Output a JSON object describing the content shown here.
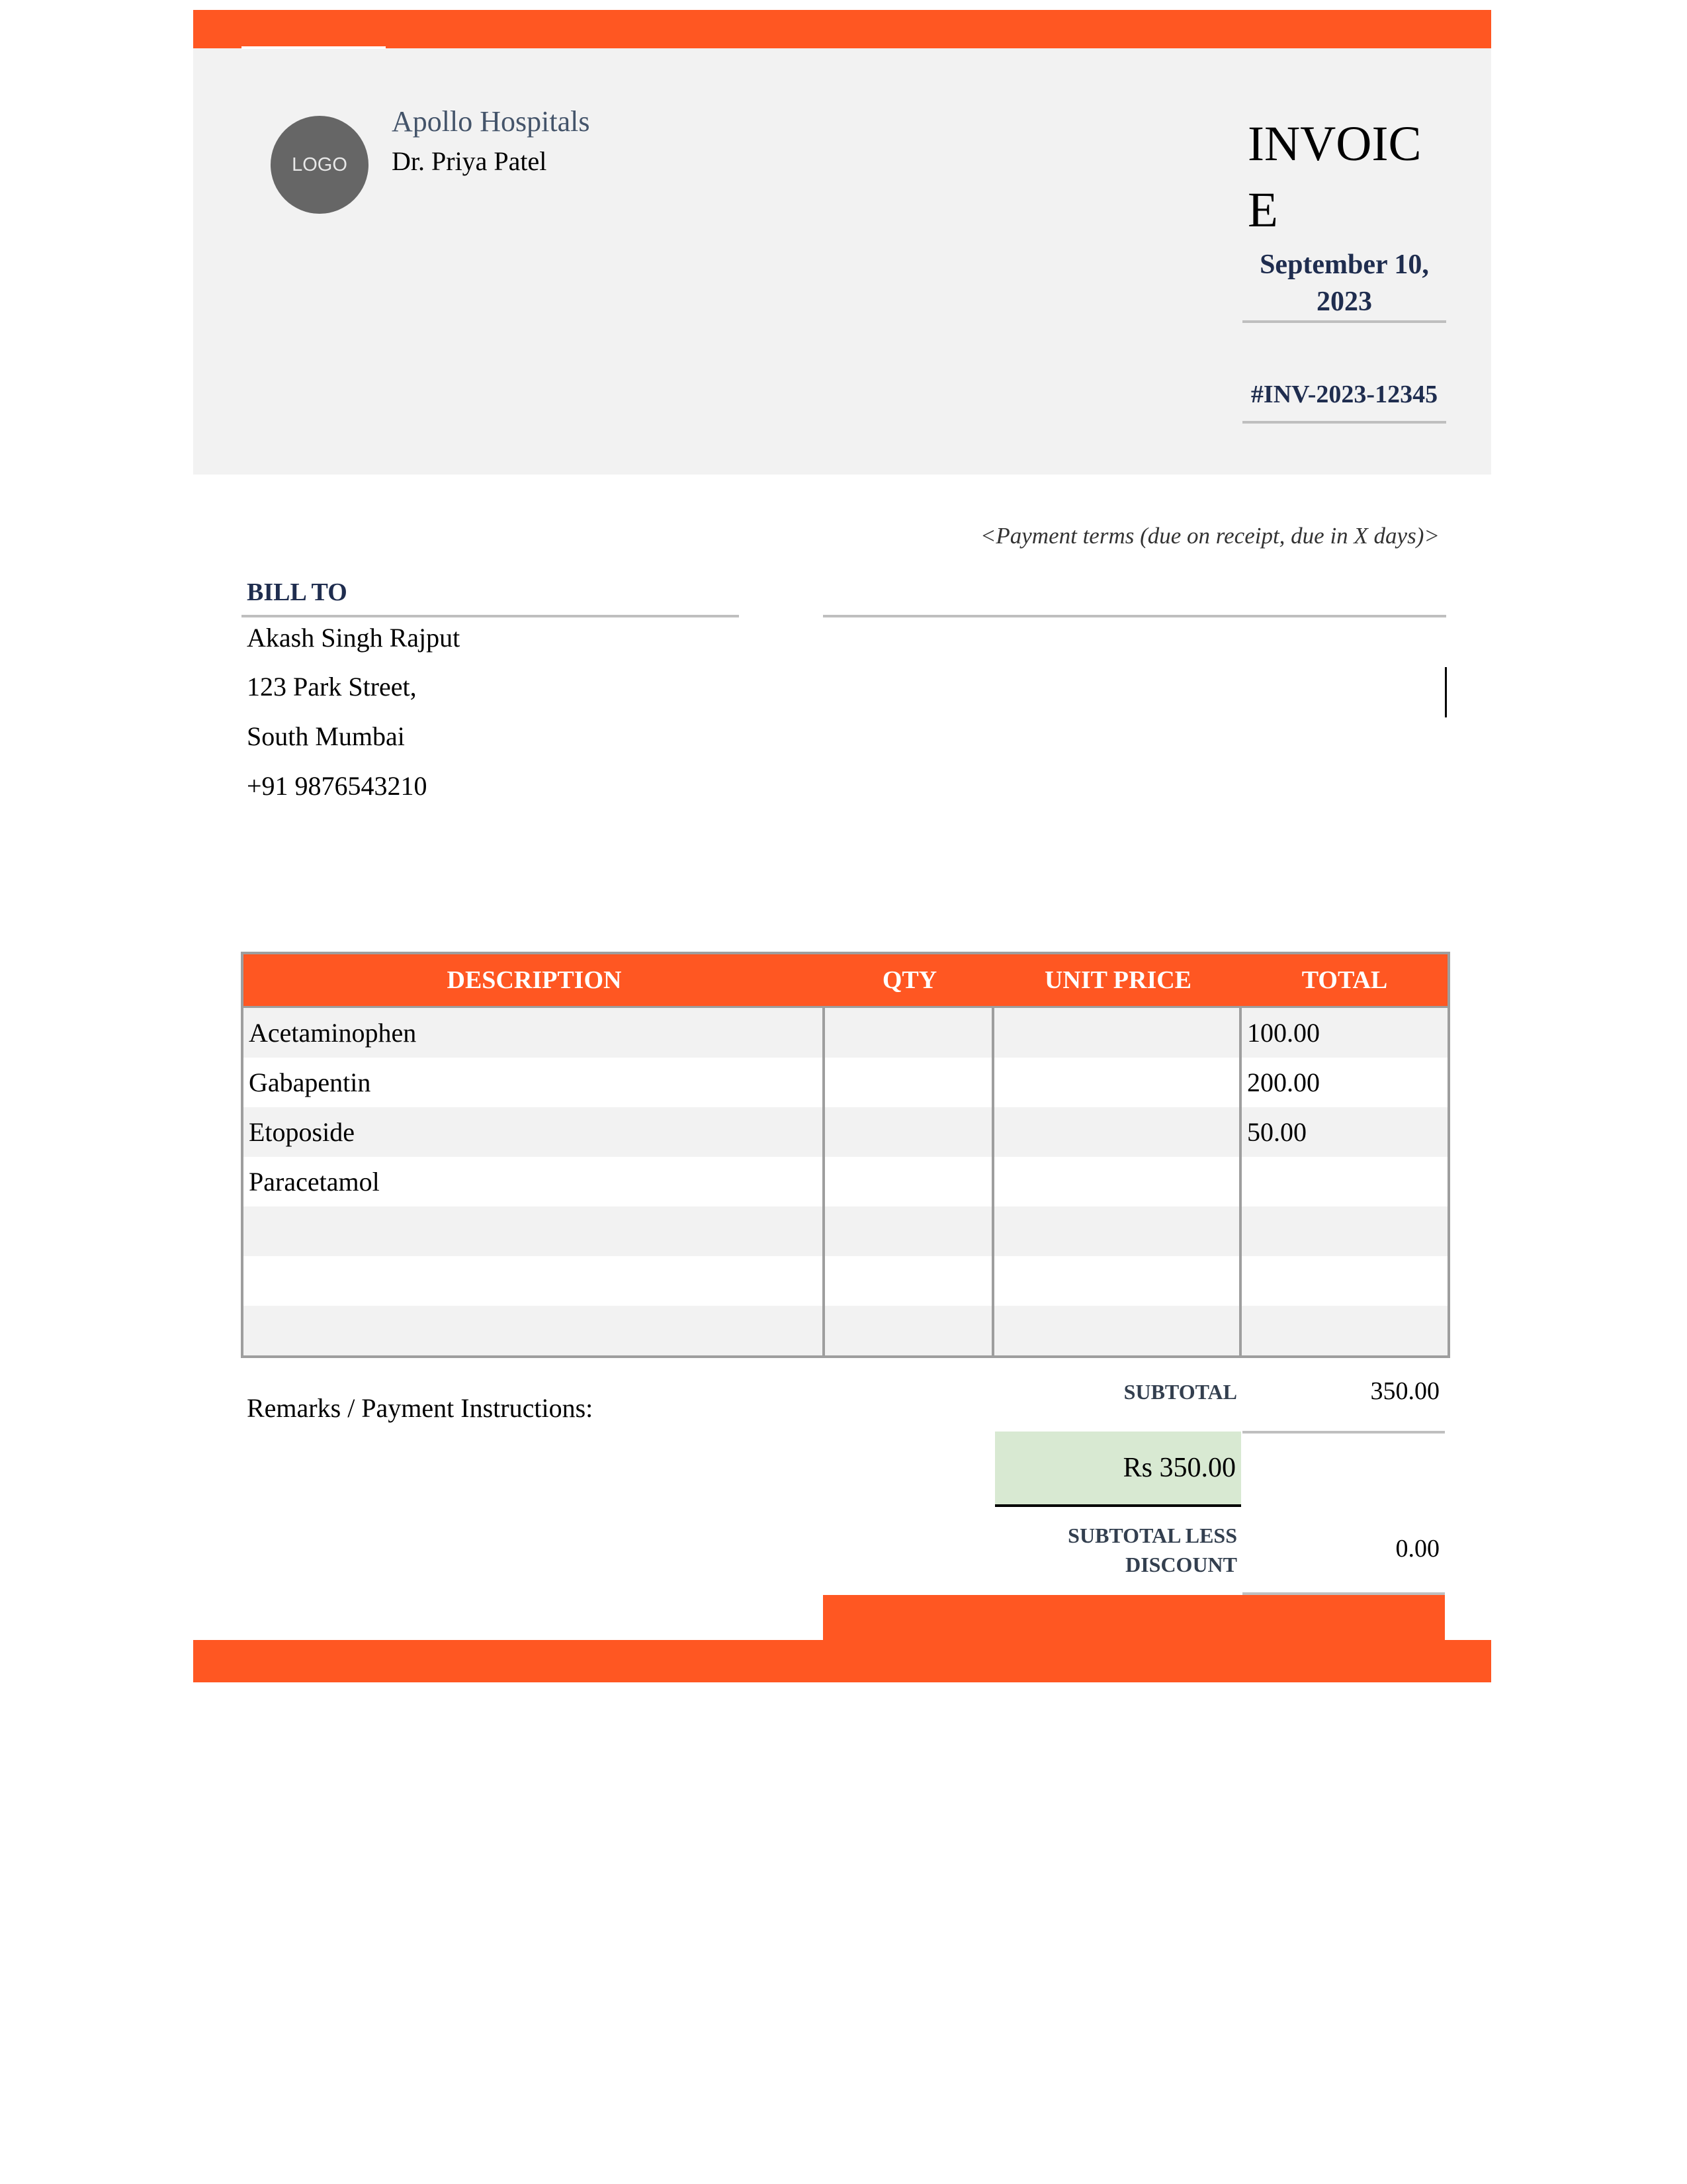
{
  "header": {
    "logo_text": "LOGO",
    "company_name": "Apollo Hospitals",
    "doctor_name": "Dr. Priya Patel",
    "title": "INVOICE",
    "date": "September 10, 2023",
    "invoice_number": "#INV-2023-12345"
  },
  "payment_terms": "<Payment terms (due on receipt, due in X days)>",
  "bill_to": {
    "label": "BILL TO",
    "name": "Akash Singh Rajput",
    "address_line1": "123 Park Street,",
    "address_line2": "South Mumbai",
    "phone": "+91 9876543210"
  },
  "table": {
    "headers": [
      "DESCRIPTION",
      "QTY",
      "UNIT PRICE",
      "TOTAL"
    ],
    "rows": [
      [
        "Acetaminophen",
        "",
        "",
        "100.00"
      ],
      [
        "Gabapentin",
        "",
        "",
        "200.00"
      ],
      [
        "Etoposide",
        "",
        "",
        "50.00"
      ],
      [
        "Paracetamol",
        "",
        "",
        ""
      ],
      [
        "",
        "",
        "",
        ""
      ],
      [
        "",
        "",
        "",
        ""
      ],
      [
        "",
        "",
        "",
        ""
      ]
    ]
  },
  "remarks_label": "Remarks / Payment Instructions:",
  "totals": {
    "subtotal_label": "SUBTOTAL",
    "subtotal_value": "350.00",
    "highlight_amount": "Rs 350.00",
    "discount_label": "SUBTOTAL LESS DISCOUNT",
    "discount_value": "0.00"
  },
  "colors": {
    "accent": "#FF5722",
    "panel": "#F2F2F2",
    "navy": "#1F2D4F",
    "highlight": "#D8E9D2"
  }
}
